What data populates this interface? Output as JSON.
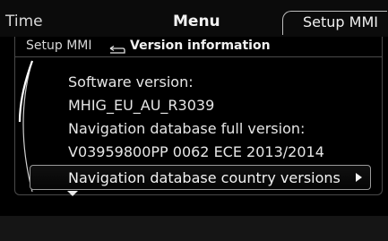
{
  "header": {
    "tab_left": "Time",
    "tab_center": "Menu",
    "tab_right": "Setup MMI"
  },
  "breadcrumb": {
    "parent": "Setup MMI",
    "current": "Version information",
    "arrow_icon": "return-arrow-icon"
  },
  "items": [
    {
      "label": "Software version:"
    },
    {
      "label": "MHIG_EU_AU_R3039"
    },
    {
      "label": "Navigation database full version:"
    },
    {
      "label": "V03959800PP 0062 ECE 2013/2014"
    }
  ],
  "selected_item": {
    "label": "Navigation database country versions",
    "icon": "chevron-right-icon"
  },
  "colors": {
    "background": "#000000",
    "text": "#e8e8e8",
    "border": "#9a9a9a"
  }
}
